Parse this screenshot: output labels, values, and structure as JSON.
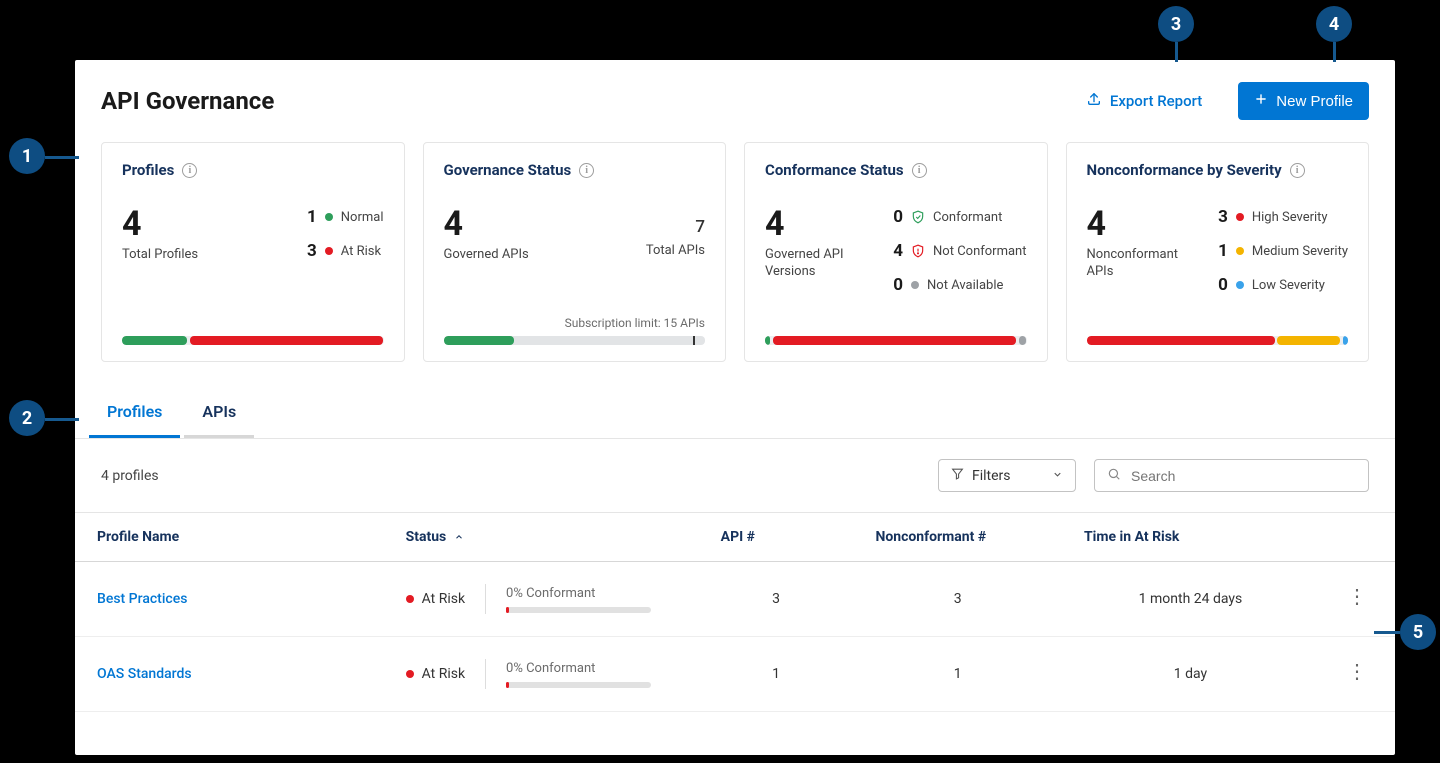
{
  "page": {
    "title": "API Governance"
  },
  "actions": {
    "export": "Export Report",
    "new_profile": "New Profile"
  },
  "cards": {
    "profiles": {
      "title": "Profiles",
      "total": "4",
      "total_label": "Total Profiles",
      "normal_count": "1",
      "normal_label": "Normal",
      "atrisk_count": "3",
      "atrisk_label": "At Risk"
    },
    "governance": {
      "title": "Governance Status",
      "governed": "4",
      "governed_label": "Governed APIs",
      "total_apis": "7",
      "total_apis_label": "Total APIs",
      "subscription_note": "Subscription limit: 15 APIs"
    },
    "conformance": {
      "title": "Conformance Status",
      "governed_versions": "4",
      "governed_versions_label": "Governed API Versions",
      "conformant_count": "0",
      "conformant_label": "Conformant",
      "not_conformant_count": "4",
      "not_conformant_label": "Not Conformant",
      "not_available_count": "0",
      "not_available_label": "Not Available"
    },
    "severity": {
      "title": "Nonconformance by Severity",
      "nonconformant_apis": "4",
      "nonconformant_apis_label": "Nonconformant APIs",
      "high_count": "3",
      "high_label": "High Severity",
      "med_count": "1",
      "med_label": "Medium Severity",
      "low_count": "0",
      "low_label": "Low Severity"
    }
  },
  "tabs": {
    "profiles": "Profiles",
    "apis": "APIs"
  },
  "toolbar": {
    "count": "4 profiles",
    "filters": "Filters",
    "search_placeholder": "Search"
  },
  "table": {
    "headers": {
      "name": "Profile Name",
      "status": "Status",
      "api_count": "API #",
      "nonconf_count": "Nonconformant #",
      "time_at_risk": "Time in At Risk"
    },
    "rows": [
      {
        "name": "Best Practices",
        "status": "At Risk",
        "conf_pct": "0% Conformant",
        "api_count": "3",
        "nonconf_count": "3",
        "time_at_risk": "1 month 24 days"
      },
      {
        "name": "OAS Standards",
        "status": "At Risk",
        "conf_pct": "0% Conformant",
        "api_count": "1",
        "nonconf_count": "1",
        "time_at_risk": "1 day"
      }
    ]
  },
  "colors": {
    "primary": "#0176d3",
    "green": "#2e9e5b",
    "red": "#e31b23",
    "amber": "#f4b400",
    "blue_light": "#3aa2ea",
    "annotation": "#0e4d82"
  },
  "annotations": [
    "1",
    "2",
    "3",
    "4",
    "5"
  ],
  "chart_data": [
    {
      "type": "bar",
      "title": "Profiles",
      "categories": [
        "Normal",
        "At Risk"
      ],
      "values": [
        1,
        3
      ],
      "total": 4
    },
    {
      "type": "bar",
      "title": "Governance Status",
      "categories": [
        "Governed APIs",
        "Total APIs",
        "Subscription limit"
      ],
      "values": [
        4,
        7,
        15
      ]
    },
    {
      "type": "bar",
      "title": "Conformance Status",
      "categories": [
        "Conformant",
        "Not Conformant",
        "Not Available"
      ],
      "values": [
        0,
        4,
        0
      ],
      "total": 4
    },
    {
      "type": "bar",
      "title": "Nonconformance by Severity",
      "categories": [
        "High Severity",
        "Medium Severity",
        "Low Severity"
      ],
      "values": [
        3,
        1,
        0
      ],
      "total": 4
    }
  ]
}
